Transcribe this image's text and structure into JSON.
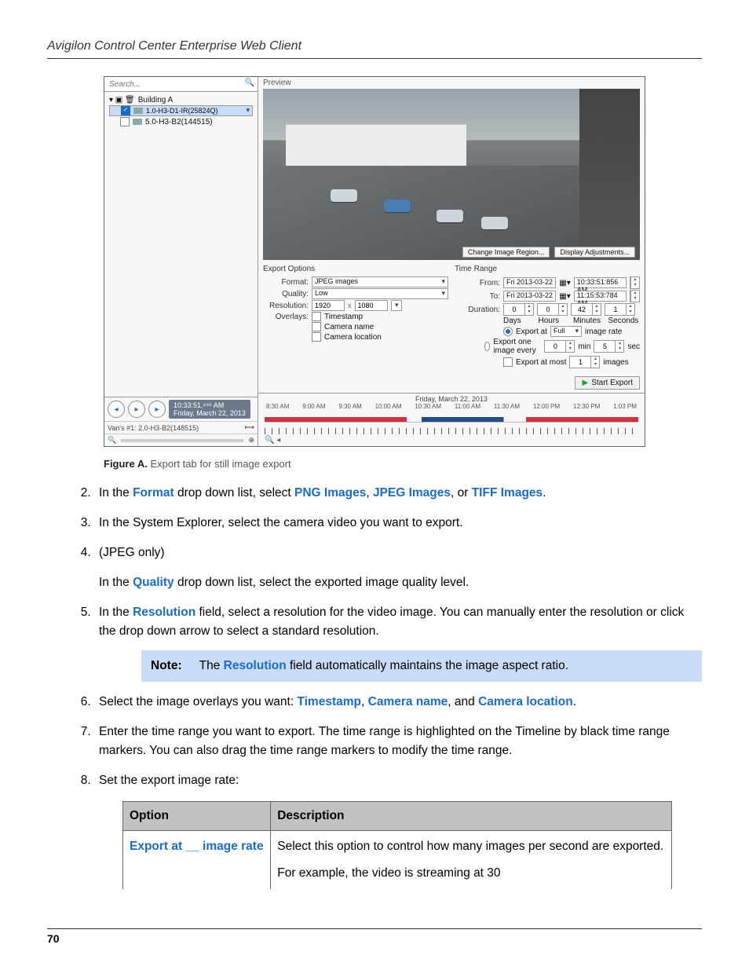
{
  "runningHead": "Avigilon Control Center Enterprise Web Client",
  "pageNumber": "70",
  "screenshot": {
    "searchPlaceholder": "Search...",
    "tree": {
      "root": "Building A",
      "items": [
        "1.0-H3-D1-IR(25824Q)",
        "5.0-H3-B2(144515)"
      ]
    },
    "previewLabel": "Preview",
    "viewportButtons": {
      "region": "Change Image Region...",
      "adjust": "Display Adjustments..."
    },
    "exportOptions": {
      "title": "Export Options",
      "formatLabel": "Format:",
      "formatValue": "JPEG images",
      "qualityLabel": "Quality:",
      "qualityValue": "Low",
      "resolutionLabel": "Resolution:",
      "resW": "1920",
      "resH": "1080",
      "overlaysLabel": "Overlays:",
      "overlays": {
        "timestamp": "Timestamp",
        "cameraName": "Camera name",
        "cameraLocation": "Camera location"
      }
    },
    "timeRange": {
      "title": "Time Range",
      "fromLabel": "From:",
      "fromDate": "Fri 2013-03-22",
      "fromTime": "10:33:51:856 AM",
      "toLabel": "To:",
      "toDate": "Fri 2013-03-22",
      "toTime": "11:15:53:784 AM",
      "durationLabel": "Duration:",
      "d": "0",
      "h": "0",
      "m": "42",
      "s": "1",
      "units": {
        "d": "Days",
        "h": "Hours",
        "m": "Minutes",
        "s": "Seconds"
      },
      "rateA": {
        "pre": "Export at",
        "sel": "Full",
        "post": "image rate"
      },
      "rateB": {
        "pre": "Export one image every",
        "v1": "0",
        "u1": "min",
        "v2": "5",
        "u2": "sec"
      },
      "rateC": {
        "pre": "Export at most",
        "v": "1",
        "post": "images"
      }
    },
    "startExport": "Start Export",
    "playback": {
      "time": "10:33:51.⁸⁵⁶ AM",
      "date": "Friday, March 22, 2013",
      "van": "Van's #1: 2.0-H3-B2(148515)"
    },
    "timeline": {
      "date": "Friday, March 22, 2013",
      "ticks": [
        "8:30 AM",
        "9:00 AM",
        "9:30 AM",
        "10:00 AM",
        "10:30 AM",
        "11:00 AM",
        "11:30 AM",
        "12:00 PM",
        "12:30 PM",
        "1:03 PM"
      ]
    }
  },
  "figureCaption": {
    "label": "Figure A.",
    "text": "Export tab for still image export"
  },
  "steps": {
    "s2a": "In the ",
    "s2b": "Format",
    "s2c": " drop down list, select ",
    "s2d": "PNG Images",
    "s2e": ", ",
    "s2f": "JPEG Images",
    "s2g": ", or ",
    "s2h": "TIFF Images",
    "s2i": ".",
    "s3": "In the System Explorer, select the camera video you want to export.",
    "s4a": "(JPEG only)",
    "s4b1": "In the ",
    "s4b2": "Quality",
    "s4b3": " drop down list, select the exported image quality level.",
    "s5a": "In the ",
    "s5b": "Resolution",
    "s5c": " field, select a resolution for the video image. You can manually enter the resolution or click the drop down arrow to select a standard resolution.",
    "noteLabel": "Note:",
    "noteA": "The ",
    "noteB": "Resolution",
    "noteC": " field automatically maintains the image aspect ratio.",
    "s6a": "Select the image overlays you want: ",
    "s6b": "Timestamp",
    "s6c": ", ",
    "s6d": "Camera name",
    "s6e": ", and ",
    "s6f": "Camera location",
    "s6g": ".",
    "s7": "Enter the time range you want to export. The time range is highlighted on the Timeline by black time range markers. You can also drag the time range markers to modify the time range.",
    "s8": "Set the export image rate:"
  },
  "table": {
    "hOption": "Option",
    "hDesc": "Description",
    "r1opt": "Export at __ image rate",
    "r1d1": "Select this option to control how many images per second are exported.",
    "r1d2": "For example, the video is streaming at 30"
  }
}
